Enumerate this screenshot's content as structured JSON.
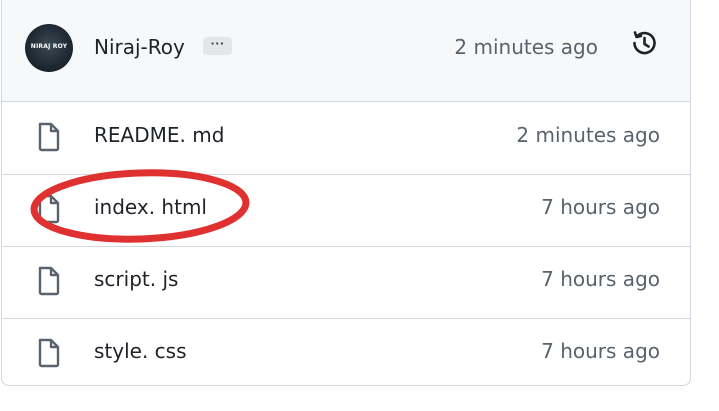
{
  "latest_commit": {
    "author": "Niraj-Roy",
    "avatar_text": "NIRAJ ROY",
    "ellipsis": "···",
    "time": "2 minutes ago"
  },
  "files": [
    {
      "name": "README. md",
      "time": "2 minutes ago"
    },
    {
      "name": "index. html",
      "time": "7 hours ago"
    },
    {
      "name": "script. js",
      "time": "7 hours ago"
    },
    {
      "name": "style. css",
      "time": "7 hours ago"
    }
  ],
  "annotation": {
    "color": "#e03131",
    "target": "index. html"
  },
  "colors": {
    "border": "#d0d7de",
    "header_bg": "#f6f8fa",
    "muted_text": "#59636e"
  }
}
